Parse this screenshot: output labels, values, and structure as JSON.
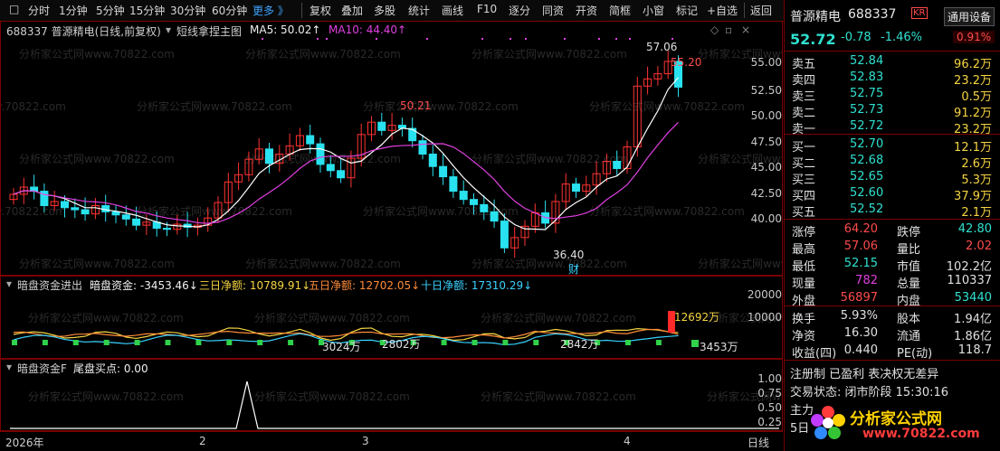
{
  "toolbar": {
    "items": [
      "分时",
      "1分钟",
      "5分钟",
      "15分钟",
      "30分钟",
      "60分钟",
      "更多 》",
      "复权",
      "叠加",
      "多股",
      "统计",
      "画线",
      "F10",
      "逐分",
      "同资",
      "开资",
      "简框",
      "小窗",
      "标记",
      "+自选",
      "返回"
    ]
  },
  "main_chart": {
    "caption_code": "688337 普源精电(日线,前复权)",
    "caption_indicator": "短线拿捏主图",
    "ma5_label": "MA5: 50.02↑",
    "ma10_label": "MA10: 44.40↑",
    "price_axis": [
      "55.00",
      "52.50",
      "50.00",
      "47.50",
      "45.00",
      "42.50",
      "40.00"
    ],
    "annot_high_peak": "57.06",
    "annot_high_close": "55.20",
    "annot_mid_high": "50.21",
    "annot_low": "36.40",
    "annot_cai": "财",
    "colors": {
      "up": "#ff3232",
      "down": "#29e2f0",
      "ma5": "#ffffff",
      "ma10": "#e040e0"
    }
  },
  "fund_chart": {
    "title": "暗盘资金进出",
    "value_label": "暗盘资金: -3453.46↓",
    "three_day": "三日净额: 10789.91↓",
    "five_day": "五日净额: 12702.05↓",
    "ten_day": "十日净额: 17310.29↓",
    "axis": [
      "20000",
      "10000"
    ],
    "annot_12692": "12692万",
    "annot_3453": "3453万",
    "annot_3024": "3024万",
    "annot_2802": "2802万",
    "annot_2842": "2842万"
  },
  "tail_chart": {
    "title": "暗盘资金F",
    "value_label": "尾盘买点: 0.00",
    "axis": [
      "1.00",
      "0.75",
      "0.50",
      "0.25"
    ]
  },
  "x_axis": {
    "labels": [
      "2026年",
      "2",
      "3",
      "4"
    ],
    "period": "日线"
  },
  "watermark": "分析家公式网www.70822.com",
  "right_panel": {
    "stock_name": "普源精电",
    "stock_code": "688337",
    "kr_badge": "KR",
    "button": "通用设备",
    "price": "52.72",
    "change": "-0.78",
    "change_pct": "-1.46%",
    "turnover_pct": "0.91%",
    "asks": [
      {
        "label": "卖五",
        "price": "52.84",
        "vol": "96.2万"
      },
      {
        "label": "卖四",
        "price": "52.83",
        "vol": "23.2万"
      },
      {
        "label": "卖三",
        "price": "52.75",
        "vol": "0.5万"
      },
      {
        "label": "卖二",
        "price": "52.73",
        "vol": "91.2万"
      },
      {
        "label": "卖一",
        "price": "52.72",
        "vol": "23.2万"
      }
    ],
    "bids": [
      {
        "label": "买一",
        "price": "52.70",
        "vol": "12.1万"
      },
      {
        "label": "买二",
        "price": "52.68",
        "vol": "2.6万"
      },
      {
        "label": "买三",
        "price": "52.65",
        "vol": "5.3万"
      },
      {
        "label": "买四",
        "price": "52.60",
        "vol": "37.9万"
      },
      {
        "label": "买五",
        "price": "52.52",
        "vol": "2.1万"
      }
    ],
    "stats": [
      {
        "l1": "涨停",
        "v1": "64.20",
        "l2": "跌停",
        "v2": "42.80"
      },
      {
        "l1": "最高",
        "v1": "57.06",
        "l2": "量比",
        "v2": "2.02"
      },
      {
        "l1": "最低",
        "v1": "52.15",
        "l2": "市值",
        "v2": "102.2亿"
      },
      {
        "l1": "现量",
        "v1": "782",
        "l2": "总量",
        "v2": "110337"
      },
      {
        "l1": "外盘",
        "v1": "56897",
        "l2": "内盘",
        "v2": "53440"
      }
    ],
    "stats2": [
      {
        "l1": "换手",
        "v1": "5.93%",
        "l2": "股本",
        "v2": "1.94亿"
      },
      {
        "l1": "净资",
        "v1": "16.30",
        "l2": "流通",
        "v2": "1.86亿"
      },
      {
        "l1": "收益(四)",
        "v1": "0.440",
        "l2": "PE(动)",
        "v2": "118.7"
      }
    ],
    "reg_line": "注册制 已盈利 表决权无差异",
    "status_line": "交易状态: 闭市阶段 15:30:16",
    "extra1": "主力",
    "extra2": "5日",
    "logo_text": "分析家公式网",
    "logo_url": "www.70822.com"
  }
}
